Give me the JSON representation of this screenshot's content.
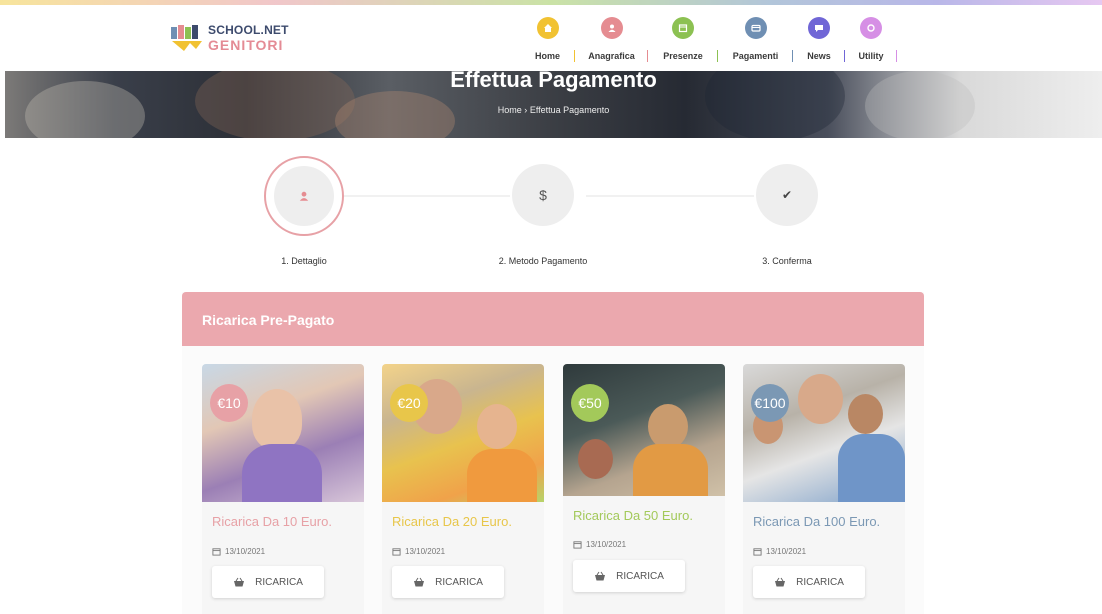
{
  "brand": {
    "line1": "SCHOOL.NET",
    "line2": "GENITORI"
  },
  "nav": [
    {
      "label": "Home",
      "color": "#f1c232",
      "icon": "home-icon"
    },
    {
      "label": "Anagrafica",
      "color": "#e58c91",
      "icon": "user-icon"
    },
    {
      "label": "Presenze",
      "color": "#8cc152",
      "icon": "calendar-icon"
    },
    {
      "label": "Pagamenti",
      "color": "#6f8fb3",
      "icon": "card-icon"
    },
    {
      "label": "News",
      "color": "#7066d6",
      "icon": "chat-icon"
    },
    {
      "label": "Utility",
      "color": "#d68fe5",
      "icon": "tools-icon"
    }
  ],
  "hero": {
    "title": "Effettua Pagamento",
    "breadcrumb_home": "Home",
    "breadcrumb_sep": "›",
    "breadcrumb_current": "Effettua Pagamento"
  },
  "steps": [
    {
      "label": "1. Dettaglio",
      "icon": "user-icon",
      "active": true
    },
    {
      "label": "2. Metodo Pagamento",
      "icon": "dollar-icon",
      "symbol": "$",
      "active": false
    },
    {
      "label": "3. Conferma",
      "icon": "check-icon",
      "symbol": "✔",
      "active": false
    }
  ],
  "panel": {
    "title": "Ricarica Pre-Pagato"
  },
  "cards": [
    {
      "price": "€10",
      "title": "Ricarica Da 10 Euro.",
      "date": "13/10/2021",
      "button": "RICARICA",
      "accent": "#e7a1a6"
    },
    {
      "price": "€20",
      "title": "Ricarica Da 20 Euro.",
      "date": "13/10/2021",
      "button": "RICARICA",
      "accent": "#e8c64a"
    },
    {
      "price": "€50",
      "title": "Ricarica Da 50 Euro.",
      "date": "13/10/2021",
      "button": "RICARICA",
      "accent": "#a3c95a"
    },
    {
      "price": "€100",
      "title": "Ricarica Da 100 Euro.",
      "date": "13/10/2021",
      "button": "RICARICA",
      "accent": "#7b98b4"
    }
  ],
  "colors": {
    "pink": "#eba8ae",
    "yellow": "#e8c64a",
    "green": "#a3c95a",
    "blue": "#7b98b4"
  }
}
